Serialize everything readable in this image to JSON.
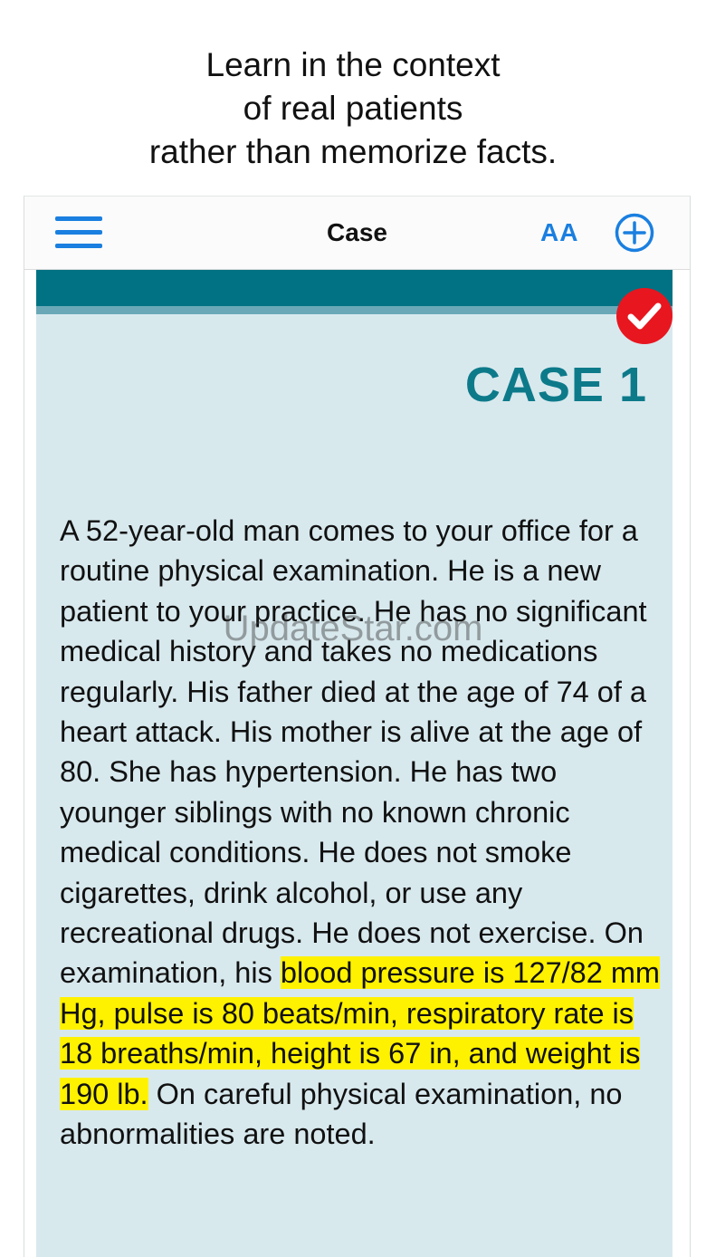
{
  "tagline": {
    "line1": "Learn in the context",
    "line2": "of real patients",
    "line3": "rather than memorize facts."
  },
  "navbar": {
    "menu_icon": "hamburger-menu-icon",
    "title": "Case",
    "font_size_label": "AA",
    "add_icon": "plus-circle-icon"
  },
  "case": {
    "badge_icon": "checkmark-icon",
    "heading": "CASE 1",
    "text_before_highlight": "A 52-year-old man comes to your office for a routine physical examination. He is a new patient to your practice. He has no significant medical history and takes no medications regularly. His father died at the age of 74 of a heart attack. His mother is alive at the age of 80. She has hypertension. He has two younger siblings with no known chronic medical conditions. He does not smoke cigarettes, drink alcohol, or use any recreational drugs. He does not exercise. On examination, his ",
    "highlighted_text": "blood pressure is 127/82 mm Hg, pulse is 80 beats/min, respiratory rate is 18 breaths/min, height is 67 in, and weight is 190 lb.",
    "text_after_highlight": " On careful physical examination, no abnormalities are noted."
  },
  "watermark": "UpdateStar.com",
  "colors": {
    "accent_blue": "#1a7fe0",
    "teal": "#007283",
    "heading_teal": "#0d7a8a",
    "content_bg": "#d8e9ee",
    "highlight": "#fff200",
    "badge_red": "#e8161f"
  }
}
